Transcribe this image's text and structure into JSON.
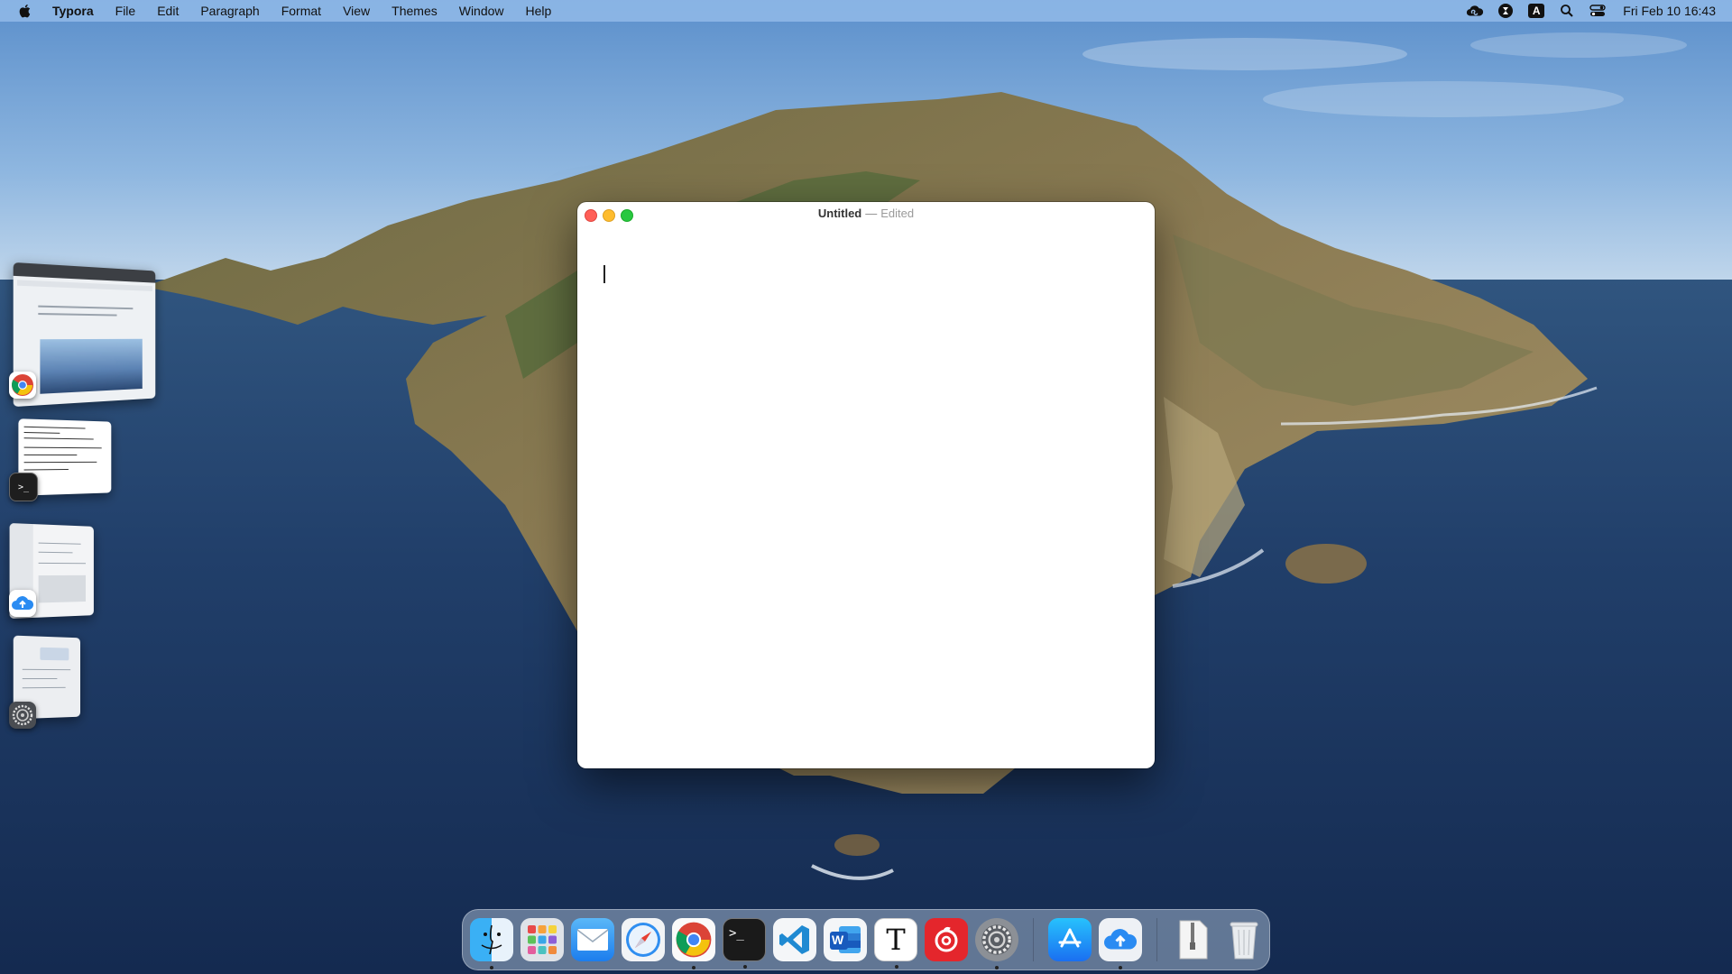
{
  "menubar": {
    "app_name": "Typora",
    "menus": [
      "File",
      "Edit",
      "Paragraph",
      "Format",
      "View",
      "Themes",
      "Window",
      "Help"
    ],
    "status_icons": [
      "creative-cloud-icon",
      "hourglass-icon",
      "input-source-a-icon",
      "spotlight-search-icon",
      "control-center-icon"
    ],
    "input_source_letter": "A",
    "clock": "Fri Feb 10  16:43"
  },
  "window": {
    "title": "Untitled",
    "separator": "—",
    "status": "Edited"
  },
  "stage_manager": [
    {
      "app": "Google Chrome",
      "icon": "chrome-icon"
    },
    {
      "app": "Terminal",
      "icon": "terminal-icon"
    },
    {
      "app": "Upload app",
      "icon": "cloud-upload-icon"
    },
    {
      "app": "System Preferences",
      "icon": "settings-gear-icon"
    }
  ],
  "dock": {
    "items": [
      {
        "name": "Finder",
        "icon": "finder-icon",
        "running": true
      },
      {
        "name": "Launchpad",
        "icon": "launchpad-icon",
        "running": false
      },
      {
        "name": "Mail",
        "icon": "mail-icon",
        "running": false
      },
      {
        "name": "Safari",
        "icon": "safari-icon",
        "running": false
      },
      {
        "name": "Google Chrome",
        "icon": "chrome-icon",
        "running": true
      },
      {
        "name": "Terminal",
        "icon": "terminal-icon",
        "running": true
      },
      {
        "name": "Visual Studio Code",
        "icon": "vscode-icon",
        "running": false
      },
      {
        "name": "Microsoft Word",
        "icon": "word-icon",
        "running": false
      },
      {
        "name": "Typora",
        "icon": "typora-icon",
        "running": true
      },
      {
        "name": "NetEase Music",
        "icon": "netease-music-icon",
        "running": false
      },
      {
        "name": "System Preferences",
        "icon": "settings-gear-icon",
        "running": true
      },
      {
        "name": "App Store",
        "icon": "app-store-icon",
        "running": false
      },
      {
        "name": "Upload app",
        "icon": "cloud-upload-icon",
        "running": true
      },
      {
        "name": "Archive",
        "icon": "zip-archive-icon",
        "running": false
      },
      {
        "name": "Trash",
        "icon": "trash-icon",
        "running": false
      }
    ],
    "word_letter": "W",
    "typora_letter": "T",
    "terminal_prompt": ">_"
  },
  "colors": {
    "close": "#ff5f57",
    "minimize": "#febc2e",
    "zoom": "#28c840",
    "ocean": "#1d3a64",
    "sky": "#7fabdb"
  }
}
